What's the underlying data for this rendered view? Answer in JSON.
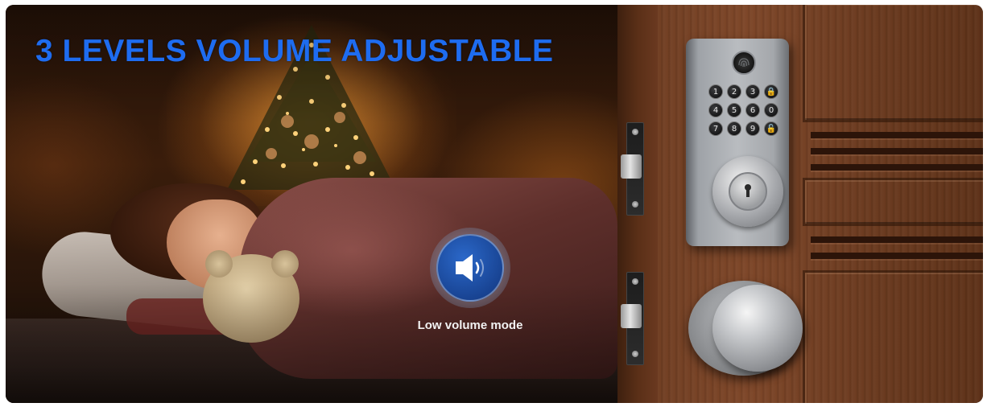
{
  "banner": {
    "headline": "3 LEVELS VOLUME ADJUSTABLE",
    "headline_color": "#1e6cf0",
    "volume_mode_label": "Low volume mode",
    "volume_icon": "speaker-low-volume-icon"
  },
  "lock": {
    "keypad_keys": [
      "1",
      "2",
      "3",
      "🔒",
      "4",
      "5",
      "6",
      "0",
      "7",
      "8",
      "9",
      "🔓"
    ],
    "fingerprint_icon": "fingerprint-sensor-icon",
    "key_cylinder_icon": "keyhole-icon"
  }
}
